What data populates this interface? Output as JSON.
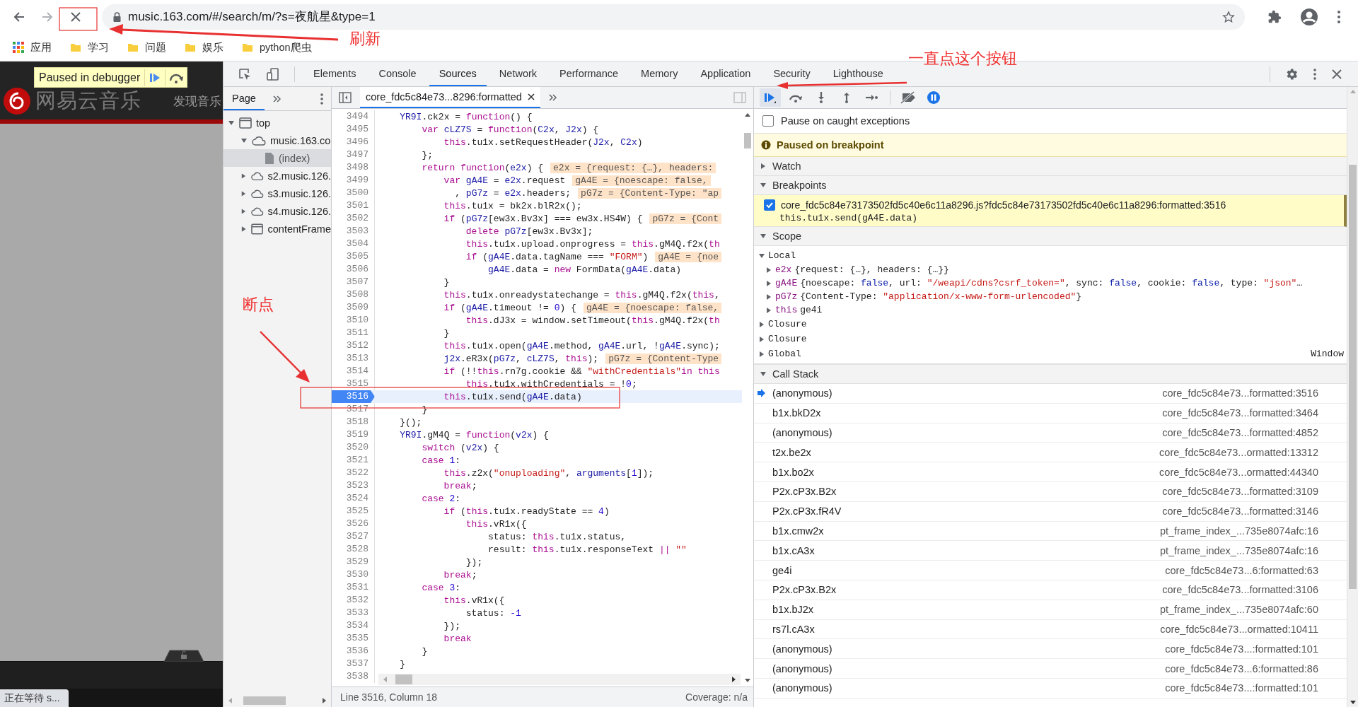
{
  "browser": {
    "url": "music.163.com/#/search/m/?s=夜航星&type=1",
    "bookmarks": [
      {
        "kind": "apps",
        "label": "应用"
      },
      {
        "kind": "folder",
        "label": "学习"
      },
      {
        "kind": "folder",
        "label": "问题"
      },
      {
        "kind": "folder",
        "label": "娱乐"
      },
      {
        "kind": "folder",
        "label": "python爬虫"
      }
    ]
  },
  "page": {
    "logo_text": "网易云音乐",
    "nav_link": "发现音乐",
    "tooltip": "Paused in debugger",
    "status": "正在等待 s..."
  },
  "devtools": {
    "tabs": [
      {
        "label": "Elements",
        "selected": false
      },
      {
        "label": "Console",
        "selected": false
      },
      {
        "label": "Sources",
        "selected": true
      },
      {
        "label": "Network",
        "selected": false
      },
      {
        "label": "Performance",
        "selected": false
      },
      {
        "label": "Memory",
        "selected": false
      },
      {
        "label": "Application",
        "selected": false
      },
      {
        "label": "Security",
        "selected": false
      },
      {
        "label": "Lighthouse",
        "selected": false
      }
    ],
    "navigator": {
      "tab": "Page",
      "tree": [
        {
          "kind": "frame",
          "label": "top",
          "expanded": true,
          "children": [
            {
              "kind": "domain",
              "label": "music.163.co",
              "expanded": true,
              "children": [
                {
                  "kind": "file",
                  "label": "(index)",
                  "selected": true
                }
              ]
            },
            {
              "kind": "domain",
              "label": "s2.music.126.",
              "expanded": false
            },
            {
              "kind": "domain",
              "label": "s3.music.126.",
              "expanded": false
            },
            {
              "kind": "domain",
              "label": "s4.music.126.",
              "expanded": false
            },
            {
              "kind": "frame",
              "label": "contentFrame",
              "expanded": false
            }
          ]
        }
      ]
    },
    "editor": {
      "file_tab": "core_fdc5c84e73...8296:formatted",
      "status": "Line 3516, Column 18",
      "coverage": "Coverage: n/a",
      "lines": [
        {
          "num": "3494",
          "current": false,
          "tokens": [
            {
              "kind": "def",
              "text": "    YR9I"
            },
            {
              "kind": "txt",
              "text": ".ck2x = "
            },
            {
              "kind": "kw",
              "text": "function"
            },
            {
              "kind": "txt",
              "text": "() {"
            }
          ]
        },
        {
          "num": "3495",
          "current": false,
          "tokens": [
            {
              "kind": "kw",
              "text": "        var "
            },
            {
              "kind": "def",
              "text": "cLZ7S"
            },
            {
              "kind": "txt",
              "text": " = "
            },
            {
              "kind": "kw",
              "text": "function"
            },
            {
              "kind": "txt",
              "text": "("
            },
            {
              "kind": "def",
              "text": "C2x"
            },
            {
              "kind": "txt",
              "text": ", "
            },
            {
              "kind": "def",
              "text": "J2x"
            },
            {
              "kind": "txt",
              "text": ") {"
            }
          ]
        },
        {
          "num": "3496",
          "current": false,
          "tokens": [
            {
              "kind": "kw",
              "text": "            this"
            },
            {
              "kind": "txt",
              "text": ".tu1x.setRequestHeader("
            },
            {
              "kind": "def",
              "text": "J2x"
            },
            {
              "kind": "txt",
              "text": ", "
            },
            {
              "kind": "def",
              "text": "C2x"
            },
            {
              "kind": "txt",
              "text": ")"
            }
          ]
        },
        {
          "num": "3497",
          "current": false,
          "tokens": [
            {
              "kind": "txt",
              "text": "        };"
            }
          ]
        },
        {
          "num": "3498",
          "current": false,
          "inline": "e2x = {request: {…}, headers:",
          "tokens": [
            {
              "kind": "kw",
              "text": "        return function"
            },
            {
              "kind": "txt",
              "text": "("
            },
            {
              "kind": "def",
              "text": "e2x"
            },
            {
              "kind": "txt",
              "text": ") {"
            }
          ]
        },
        {
          "num": "3499",
          "current": false,
          "inline": "gA4E = {noescape: false,",
          "tokens": [
            {
              "kind": "kw",
              "text": "            var "
            },
            {
              "kind": "def",
              "text": "gA4E"
            },
            {
              "kind": "txt",
              "text": " = "
            },
            {
              "kind": "def",
              "text": "e2x"
            },
            {
              "kind": "txt",
              "text": ".request"
            }
          ]
        },
        {
          "num": "3500",
          "current": false,
          "inline": "pG7z = {Content-Type: \"ap",
          "tokens": [
            {
              "kind": "txt",
              "text": "              , "
            },
            {
              "kind": "def",
              "text": "pG7z"
            },
            {
              "kind": "txt",
              "text": " = "
            },
            {
              "kind": "def",
              "text": "e2x"
            },
            {
              "kind": "txt",
              "text": ".headers;"
            }
          ]
        },
        {
          "num": "3501",
          "current": false,
          "tokens": [
            {
              "kind": "kw",
              "text": "            this"
            },
            {
              "kind": "txt",
              "text": ".tu1x = bk2x.blR2x();"
            }
          ]
        },
        {
          "num": "3502",
          "current": false,
          "inline": "pG7z = {Cont",
          "tokens": [
            {
              "kind": "kw",
              "text": "            if"
            },
            {
              "kind": "txt",
              "text": " ("
            },
            {
              "kind": "def",
              "text": "pG7z"
            },
            {
              "kind": "txt",
              "text": "[ew3x.Bv3x] === ew3x.HS4W) {"
            }
          ]
        },
        {
          "num": "3503",
          "current": false,
          "tokens": [
            {
              "kind": "kw",
              "text": "                delete "
            },
            {
              "kind": "def",
              "text": "pG7z"
            },
            {
              "kind": "txt",
              "text": "[ew3x.Bv3x];"
            }
          ]
        },
        {
          "num": "3504",
          "current": false,
          "tokens": [
            {
              "kind": "kw",
              "text": "                this"
            },
            {
              "kind": "txt",
              "text": ".tu1x.upload.onprogress = "
            },
            {
              "kind": "kw",
              "text": "this"
            },
            {
              "kind": "txt",
              "text": ".gM4Q.f2x("
            },
            {
              "kind": "kw",
              "text": "th"
            }
          ]
        },
        {
          "num": "3505",
          "current": false,
          "inline": "gA4E = {noe",
          "tokens": [
            {
              "kind": "kw",
              "text": "                if"
            },
            {
              "kind": "txt",
              "text": " ("
            },
            {
              "kind": "def",
              "text": "gA4E"
            },
            {
              "kind": "txt",
              "text": ".data.tagName === "
            },
            {
              "kind": "str",
              "text": "\"FORM\""
            },
            {
              "kind": "txt",
              "text": ")"
            }
          ]
        },
        {
          "num": "3506",
          "current": false,
          "tokens": [
            {
              "kind": "def",
              "text": "                    gA4E"
            },
            {
              "kind": "txt",
              "text": ".data = "
            },
            {
              "kind": "kw",
              "text": "new"
            },
            {
              "kind": "txt",
              "text": " FormData("
            },
            {
              "kind": "def",
              "text": "gA4E"
            },
            {
              "kind": "txt",
              "text": ".data)"
            }
          ]
        },
        {
          "num": "3507",
          "current": false,
          "tokens": [
            {
              "kind": "txt",
              "text": "            }"
            }
          ]
        },
        {
          "num": "3508",
          "current": false,
          "tokens": [
            {
              "kind": "kw",
              "text": "            this"
            },
            {
              "kind": "txt",
              "text": ".tu1x.onreadystatechange = "
            },
            {
              "kind": "kw",
              "text": "this"
            },
            {
              "kind": "txt",
              "text": ".gM4Q.f2x("
            },
            {
              "kind": "kw",
              "text": "this"
            },
            {
              "kind": "txt",
              "text": ","
            }
          ]
        },
        {
          "num": "3509",
          "current": false,
          "inline": "gA4E = {noescape: false,",
          "tokens": [
            {
              "kind": "kw",
              "text": "            if"
            },
            {
              "kind": "txt",
              "text": " ("
            },
            {
              "kind": "def",
              "text": "gA4E"
            },
            {
              "kind": "txt",
              "text": ".timeout != "
            },
            {
              "kind": "num",
              "text": "0"
            },
            {
              "kind": "txt",
              "text": ") {"
            }
          ]
        },
        {
          "num": "3510",
          "current": false,
          "tokens": [
            {
              "kind": "kw",
              "text": "                this"
            },
            {
              "kind": "txt",
              "text": ".dJ3x = window.setTimeout("
            },
            {
              "kind": "kw",
              "text": "this"
            },
            {
              "kind": "txt",
              "text": ".gM4Q.f2x("
            },
            {
              "kind": "kw",
              "text": "th"
            }
          ]
        },
        {
          "num": "3511",
          "current": false,
          "tokens": [
            {
              "kind": "txt",
              "text": "            }"
            }
          ]
        },
        {
          "num": "3512",
          "current": false,
          "tokens": [
            {
              "kind": "kw",
              "text": "            this"
            },
            {
              "kind": "txt",
              "text": ".tu1x.open("
            },
            {
              "kind": "def",
              "text": "gA4E"
            },
            {
              "kind": "txt",
              "text": ".method, "
            },
            {
              "kind": "def",
              "text": "gA4E"
            },
            {
              "kind": "txt",
              "text": ".url, !"
            },
            {
              "kind": "def",
              "text": "gA4E"
            },
            {
              "kind": "txt",
              "text": ".sync);"
            }
          ]
        },
        {
          "num": "3513",
          "current": false,
          "inline": "pG7z = {Content-Type",
          "tokens": [
            {
              "kind": "def",
              "text": "            j2x"
            },
            {
              "kind": "txt",
              "text": ".eR3x("
            },
            {
              "kind": "def",
              "text": "pG7z"
            },
            {
              "kind": "txt",
              "text": ", "
            },
            {
              "kind": "def",
              "text": "cLZ7S"
            },
            {
              "kind": "txt",
              "text": ", "
            },
            {
              "kind": "kw",
              "text": "this"
            },
            {
              "kind": "txt",
              "text": ");"
            }
          ]
        },
        {
          "num": "3514",
          "current": false,
          "tokens": [
            {
              "kind": "kw",
              "text": "            if"
            },
            {
              "kind": "txt",
              "text": " (!!"
            },
            {
              "kind": "kw",
              "text": "this"
            },
            {
              "kind": "txt",
              "text": ".rn7g.cookie && "
            },
            {
              "kind": "str",
              "text": "\"withCredentials\""
            },
            {
              "kind": "kw",
              "text": "in this"
            }
          ]
        },
        {
          "num": "3515",
          "current": false,
          "tokens": [
            {
              "kind": "kw",
              "text": "                this"
            },
            {
              "kind": "txt",
              "text": ".tu1x.withCredentials = !"
            },
            {
              "kind": "num",
              "text": "0"
            },
            {
              "kind": "txt",
              "text": ";"
            }
          ]
        },
        {
          "num": "3516",
          "current": true,
          "tokens": [
            {
              "kind": "kw",
              "text": "            this"
            },
            {
              "kind": "txt",
              "text": ".tu1x.send("
            },
            {
              "kind": "def",
              "text": "gA4E"
            },
            {
              "kind": "txt",
              "text": ".data)"
            }
          ]
        },
        {
          "num": "3517",
          "current": false,
          "tokens": [
            {
              "kind": "txt",
              "text": "        }"
            }
          ]
        },
        {
          "num": "3518",
          "current": false,
          "tokens": [
            {
              "kind": "txt",
              "text": "    }();"
            }
          ]
        },
        {
          "num": "3519",
          "current": false,
          "tokens": [
            {
              "kind": "def",
              "text": "    YR9I"
            },
            {
              "kind": "txt",
              "text": ".gM4Q = "
            },
            {
              "kind": "kw",
              "text": "function"
            },
            {
              "kind": "txt",
              "text": "("
            },
            {
              "kind": "def",
              "text": "v2x"
            },
            {
              "kind": "txt",
              "text": ") {"
            }
          ]
        },
        {
          "num": "3520",
          "current": false,
          "tokens": [
            {
              "kind": "kw",
              "text": "        switch"
            },
            {
              "kind": "txt",
              "text": " ("
            },
            {
              "kind": "def",
              "text": "v2x"
            },
            {
              "kind": "txt",
              "text": ") {"
            }
          ]
        },
        {
          "num": "3521",
          "current": false,
          "tokens": [
            {
              "kind": "kw",
              "text": "        case "
            },
            {
              "kind": "num",
              "text": "1"
            },
            {
              "kind": "txt",
              "text": ":"
            }
          ]
        },
        {
          "num": "3522",
          "current": false,
          "tokens": [
            {
              "kind": "kw",
              "text": "            this"
            },
            {
              "kind": "txt",
              "text": ".z2x("
            },
            {
              "kind": "str",
              "text": "\"onuploading\""
            },
            {
              "kind": "txt",
              "text": ", "
            },
            {
              "kind": "def",
              "text": "arguments"
            },
            {
              "kind": "txt",
              "text": "["
            },
            {
              "kind": "num",
              "text": "1"
            },
            {
              "kind": "txt",
              "text": "]);"
            }
          ]
        },
        {
          "num": "3523",
          "current": false,
          "tokens": [
            {
              "kind": "kw",
              "text": "            break"
            },
            {
              "kind": "txt",
              "text": ";"
            }
          ]
        },
        {
          "num": "3524",
          "current": false,
          "tokens": [
            {
              "kind": "kw",
              "text": "        case "
            },
            {
              "kind": "num",
              "text": "2"
            },
            {
              "kind": "txt",
              "text": ":"
            }
          ]
        },
        {
          "num": "3525",
          "current": false,
          "tokens": [
            {
              "kind": "kw",
              "text": "            if"
            },
            {
              "kind": "txt",
              "text": " ("
            },
            {
              "kind": "kw",
              "text": "this"
            },
            {
              "kind": "txt",
              "text": ".tu1x.readyState == "
            },
            {
              "kind": "num",
              "text": "4"
            },
            {
              "kind": "txt",
              "text": ")"
            }
          ]
        },
        {
          "num": "3526",
          "current": false,
          "tokens": [
            {
              "kind": "kw",
              "text": "                this"
            },
            {
              "kind": "txt",
              "text": ".vR1x({"
            }
          ]
        },
        {
          "num": "3527",
          "current": false,
          "tokens": [
            {
              "kind": "txt",
              "text": "                    status: "
            },
            {
              "kind": "kw",
              "text": "this"
            },
            {
              "kind": "txt",
              "text": ".tu1x.status,"
            }
          ]
        },
        {
          "num": "3528",
          "current": false,
          "tokens": [
            {
              "kind": "txt",
              "text": "                    result: "
            },
            {
              "kind": "kw",
              "text": "this"
            },
            {
              "kind": "txt",
              "text": ".tu1x.responseText "
            },
            {
              "kind": "kw",
              "text": "||"
            },
            {
              "kind": "str",
              "text": " \"\""
            }
          ]
        },
        {
          "num": "3529",
          "current": false,
          "tokens": [
            {
              "kind": "txt",
              "text": "                });"
            }
          ]
        },
        {
          "num": "3530",
          "current": false,
          "tokens": [
            {
              "kind": "kw",
              "text": "            break"
            },
            {
              "kind": "txt",
              "text": ";"
            }
          ]
        },
        {
          "num": "3531",
          "current": false,
          "tokens": [
            {
              "kind": "kw",
              "text": "        case "
            },
            {
              "kind": "num",
              "text": "3"
            },
            {
              "kind": "txt",
              "text": ":"
            }
          ]
        },
        {
          "num": "3532",
          "current": false,
          "tokens": [
            {
              "kind": "kw",
              "text": "            this"
            },
            {
              "kind": "txt",
              "text": ".vR1x({"
            }
          ]
        },
        {
          "num": "3533",
          "current": false,
          "tokens": [
            {
              "kind": "txt",
              "text": "                status: "
            },
            {
              "kind": "num",
              "text": "-1"
            }
          ]
        },
        {
          "num": "3534",
          "current": false,
          "tokens": [
            {
              "kind": "txt",
              "text": "            });"
            }
          ]
        },
        {
          "num": "3535",
          "current": false,
          "tokens": [
            {
              "kind": "kw",
              "text": "            break"
            }
          ]
        },
        {
          "num": "3536",
          "current": false,
          "tokens": [
            {
              "kind": "txt",
              "text": "        }"
            }
          ]
        },
        {
          "num": "3537",
          "current": false,
          "tokens": [
            {
              "kind": "txt",
              "text": "    }"
            }
          ]
        },
        {
          "num": "3538",
          "current": false
        }
      ]
    }
  },
  "debugger": {
    "pause_on_caught": {
      "label": "Pause on caught exceptions",
      "checked": false
    },
    "banner": "Paused on breakpoint",
    "watch": {
      "title": "Watch",
      "expanded": false
    },
    "breakpoints": {
      "title": "Breakpoints",
      "expanded": true,
      "items": [
        {
          "checked": true,
          "location": "core_fdc5c84e73173502fd5c40e6c11a8296.js?fdc5c84e73173502fd5c40e6c11a8296:formatted:3516",
          "code": "this.tu1x.send(gA4E.data)"
        }
      ]
    },
    "scope": {
      "title": "Scope",
      "expanded": true,
      "groups": [
        {
          "label": "Local",
          "expanded": true,
          "entries": [
            {
              "name": "e2x",
              "expanded": false,
              "value": [
                {
                  "kind": "txt",
                  "text": "{request: {…}, headers: {…}}"
                }
              ]
            },
            {
              "name": "gA4E",
              "expanded": false,
              "value": [
                {
                  "kind": "txt",
                  "text": "{noescape: "
                },
                {
                  "kind": "atom",
                  "text": "false"
                },
                {
                  "kind": "txt",
                  "text": ", url: "
                },
                {
                  "kind": "str",
                  "text": "\"/weapi/cdns?csrf_token=\""
                },
                {
                  "kind": "txt",
                  "text": ", sync: "
                },
                {
                  "kind": "atom",
                  "text": "false"
                },
                {
                  "kind": "txt",
                  "text": ", cookie: "
                },
                {
                  "kind": "atom",
                  "text": "false"
                },
                {
                  "kind": "txt",
                  "text": ", type: "
                },
                {
                  "kind": "str",
                  "text": "\"json\""
                },
                {
                  "kind": "txt",
                  "text": "…"
                }
              ]
            },
            {
              "name": "pG7z",
              "expanded": false,
              "value": [
                {
                  "kind": "txt",
                  "text": "{Content-Type: "
                },
                {
                  "kind": "str",
                  "text": "\"application/x-www-form-urlencoded\""
                },
                {
                  "kind": "txt",
                  "text": "}"
                }
              ]
            },
            {
              "name": "this",
              "expanded": false,
              "value": [
                {
                  "kind": "txt",
                  "text": "ge4i"
                }
              ]
            }
          ]
        },
        {
          "label": "Closure",
          "expanded": false
        },
        {
          "label": "Closure",
          "expanded": false
        },
        {
          "label": "Global",
          "expanded": false,
          "value": "Window"
        }
      ]
    },
    "call_stack": {
      "title": "Call Stack",
      "expanded": true,
      "frames": [
        {
          "name": "(anonymous)",
          "location": "core_fdc5c84e73...formatted:3516",
          "selected": true
        },
        {
          "name": "b1x.bkD2x",
          "location": "core_fdc5c84e73...formatted:3464",
          "selected": false
        },
        {
          "name": "(anonymous)",
          "location": "core_fdc5c84e73...formatted:4852",
          "selected": false
        },
        {
          "name": "t2x.be2x",
          "location": "core_fdc5c84e73...ormatted:13312",
          "selected": false
        },
        {
          "name": "b1x.bo2x",
          "location": "core_fdc5c84e73...ormatted:44340",
          "selected": false
        },
        {
          "name": "P2x.cP3x.B2x",
          "location": "core_fdc5c84e73...formatted:3109",
          "selected": false
        },
        {
          "name": "P2x.cP3x.fR4V",
          "location": "core_fdc5c84e73...formatted:3146",
          "selected": false
        },
        {
          "name": "b1x.cmw2x",
          "location": "pt_frame_index_...735e8074afc:16",
          "selected": false
        },
        {
          "name": "b1x.cA3x",
          "location": "pt_frame_index_...735e8074afc:16",
          "selected": false
        },
        {
          "name": "ge4i",
          "location": "core_fdc5c84e73...6:formatted:63",
          "selected": false
        },
        {
          "name": "P2x.cP3x.B2x",
          "location": "core_fdc5c84e73...formatted:3106",
          "selected": false
        },
        {
          "name": "b1x.bJ2x",
          "location": "pt_frame_index_...735e8074afc:60",
          "selected": false
        },
        {
          "name": "rs7l.cA3x",
          "location": "core_fdc5c84e73...ormatted:10411",
          "selected": false
        },
        {
          "name": "(anonymous)",
          "location": "core_fdc5c84e73...:formatted:101",
          "selected": false
        },
        {
          "name": "(anonymous)",
          "location": "core_fdc5c84e73...6:formatted:86",
          "selected": false
        },
        {
          "name": "(anonymous)",
          "location": "core_fdc5c84e73...:formatted:101",
          "selected": false
        }
      ]
    }
  },
  "annotations": [
    {
      "text": "刷新"
    },
    {
      "text": "断点"
    },
    {
      "text": "一直点这个按钮"
    }
  ]
}
